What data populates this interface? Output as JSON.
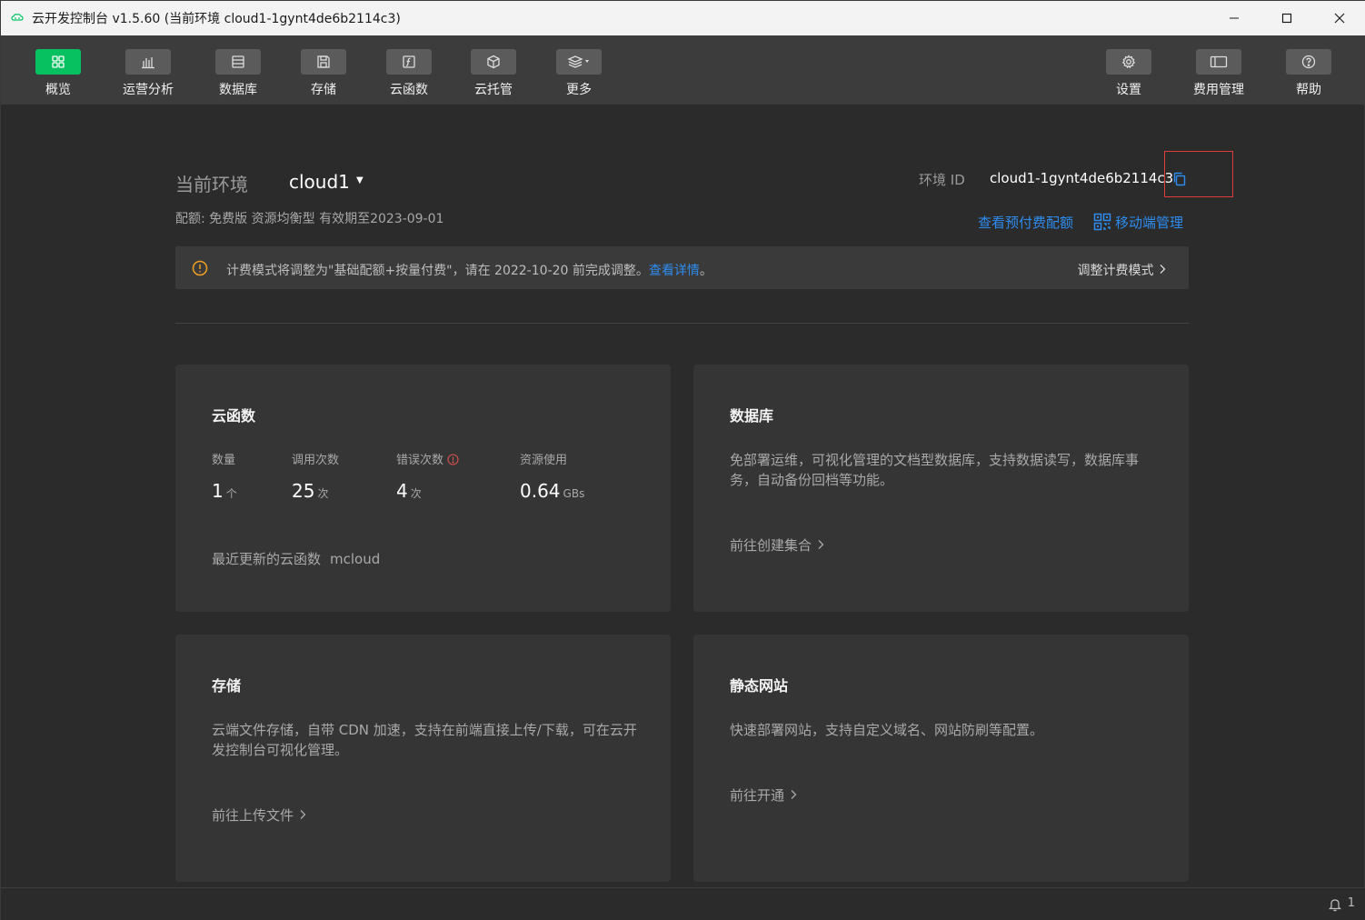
{
  "titlebar": {
    "title": "云开发控制台 v1.5.60 (当前环境 cloud1-1gynt4de6b2114c3)"
  },
  "toolbar": {
    "left": [
      {
        "label": "概览",
        "icon": "grid-icon",
        "active": true
      },
      {
        "label": "运营分析",
        "icon": "bar-chart-icon"
      },
      {
        "label": "数据库",
        "icon": "database-icon"
      },
      {
        "label": "存储",
        "icon": "storage-icon"
      },
      {
        "label": "云函数",
        "icon": "function-icon"
      },
      {
        "label": "云托管",
        "icon": "cube-icon"
      },
      {
        "label": "更多",
        "icon": "layers-icon"
      }
    ],
    "right": [
      {
        "label": "设置",
        "icon": "gear-icon"
      },
      {
        "label": "费用管理",
        "icon": "billing-icon"
      },
      {
        "label": "帮助",
        "icon": "help-icon"
      }
    ]
  },
  "env": {
    "label": "当前环境",
    "name": "cloud1",
    "quota": "配额: 免费版 资源均衡型 有效期至2023-09-01",
    "id_label": "环境 ID",
    "id_value": "cloud1-1gynt4de6b2114c3",
    "prepaid_link": "查看预付费配额",
    "mobile_link": "移动端管理"
  },
  "notice": {
    "message": "计费模式将调整为\"基础配额+按量付费\"，请在 2022-10-20 前完成调整。",
    "detail_link": "查看详情",
    "tail": "。",
    "adjust_label": "调整计费模式"
  },
  "cards": {
    "functions": {
      "title": "云函数",
      "stats": [
        {
          "label": "数量",
          "value": "1",
          "unit": "个"
        },
        {
          "label": "调用次数",
          "value": "25",
          "unit": "次"
        },
        {
          "label": "错误次数",
          "value": "4",
          "unit": "次"
        },
        {
          "label": "资源使用",
          "value": "0.64",
          "unit": "GBs"
        }
      ],
      "recent_label": "最近更新的云函数",
      "recent_name": "mcloud"
    },
    "database": {
      "title": "数据库",
      "desc": "免部署运维，可视化管理的文档型数据库，支持数据读写，数据库事务，自动备份回档等功能。",
      "link": "前往创建集合"
    },
    "storage": {
      "title": "存储",
      "desc": "云端文件存储，自带 CDN 加速，支持在前端直接上传/下载，可在云开发控制台可视化管理。",
      "link": "前往上传文件"
    },
    "hosting": {
      "title": "静态网站",
      "desc": "快速部署网站，支持自定义域名、网站防刷等配置。",
      "link": "前往开通"
    }
  },
  "statusbar": {
    "notification_count": "1"
  },
  "colors": {
    "accent_green": "#07c160",
    "link_blue": "#2e8cf0",
    "warning_orange": "#f0a020",
    "highlight_red": "#e23b3b"
  }
}
